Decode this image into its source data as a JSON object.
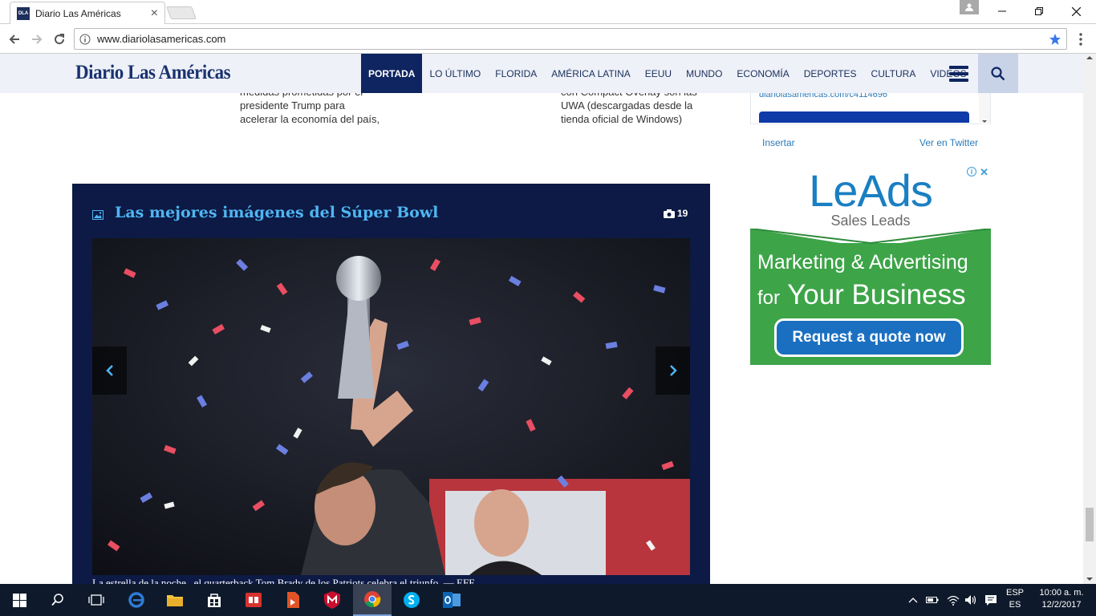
{
  "browser": {
    "tab_title": "Diario Las Américas",
    "tab_close": "×",
    "url": "www.diariolasamericas.com",
    "favicon_text": "DLA"
  },
  "site": {
    "logo": "Diario Las Américas",
    "nav": [
      "PORTADA",
      "LO ÚLTIMO",
      "FLORIDA",
      "AMÉRICA LATINA",
      "EEUU",
      "MUNDO",
      "ECONOMÍA",
      "DEPORTES",
      "CULTURA",
      "VIDEOS"
    ],
    "active_nav": "PORTADA"
  },
  "snippets": {
    "left": [
      "medidas prometidas por el",
      "presidente Trump para",
      "acelerar la economía del país,"
    ],
    "right": [
      "con Compact Overlay son las",
      "UWA (descargadas desde la",
      "tienda oficial de Windows)"
    ]
  },
  "twitter": {
    "link": "diariolasamericas.com/c4114696",
    "insert": "Insertar",
    "view": "Ver en Twitter"
  },
  "gallery": {
    "title": "Las mejores imágenes del Súper Bowl",
    "count": "19",
    "caption": "La estrella de la noche , el quarterback Tom Brady de los Patriots celebra el triunfo. — EFE"
  },
  "ad": {
    "brand": "LeAds",
    "sub": "Sales Leads",
    "line1": "Marketing & Advertising",
    "line2_small": "for",
    "line2_big": "Your Business",
    "cta": "Request a quote now",
    "info": "i",
    "close": "✕",
    "colors": {
      "green": "#3da448",
      "blue": "#1a7fc2"
    }
  },
  "taskbar": {
    "lang_top": "ESP",
    "lang_bottom": "ES",
    "time": "10:00 a. m.",
    "date": "12/2/2017"
  }
}
